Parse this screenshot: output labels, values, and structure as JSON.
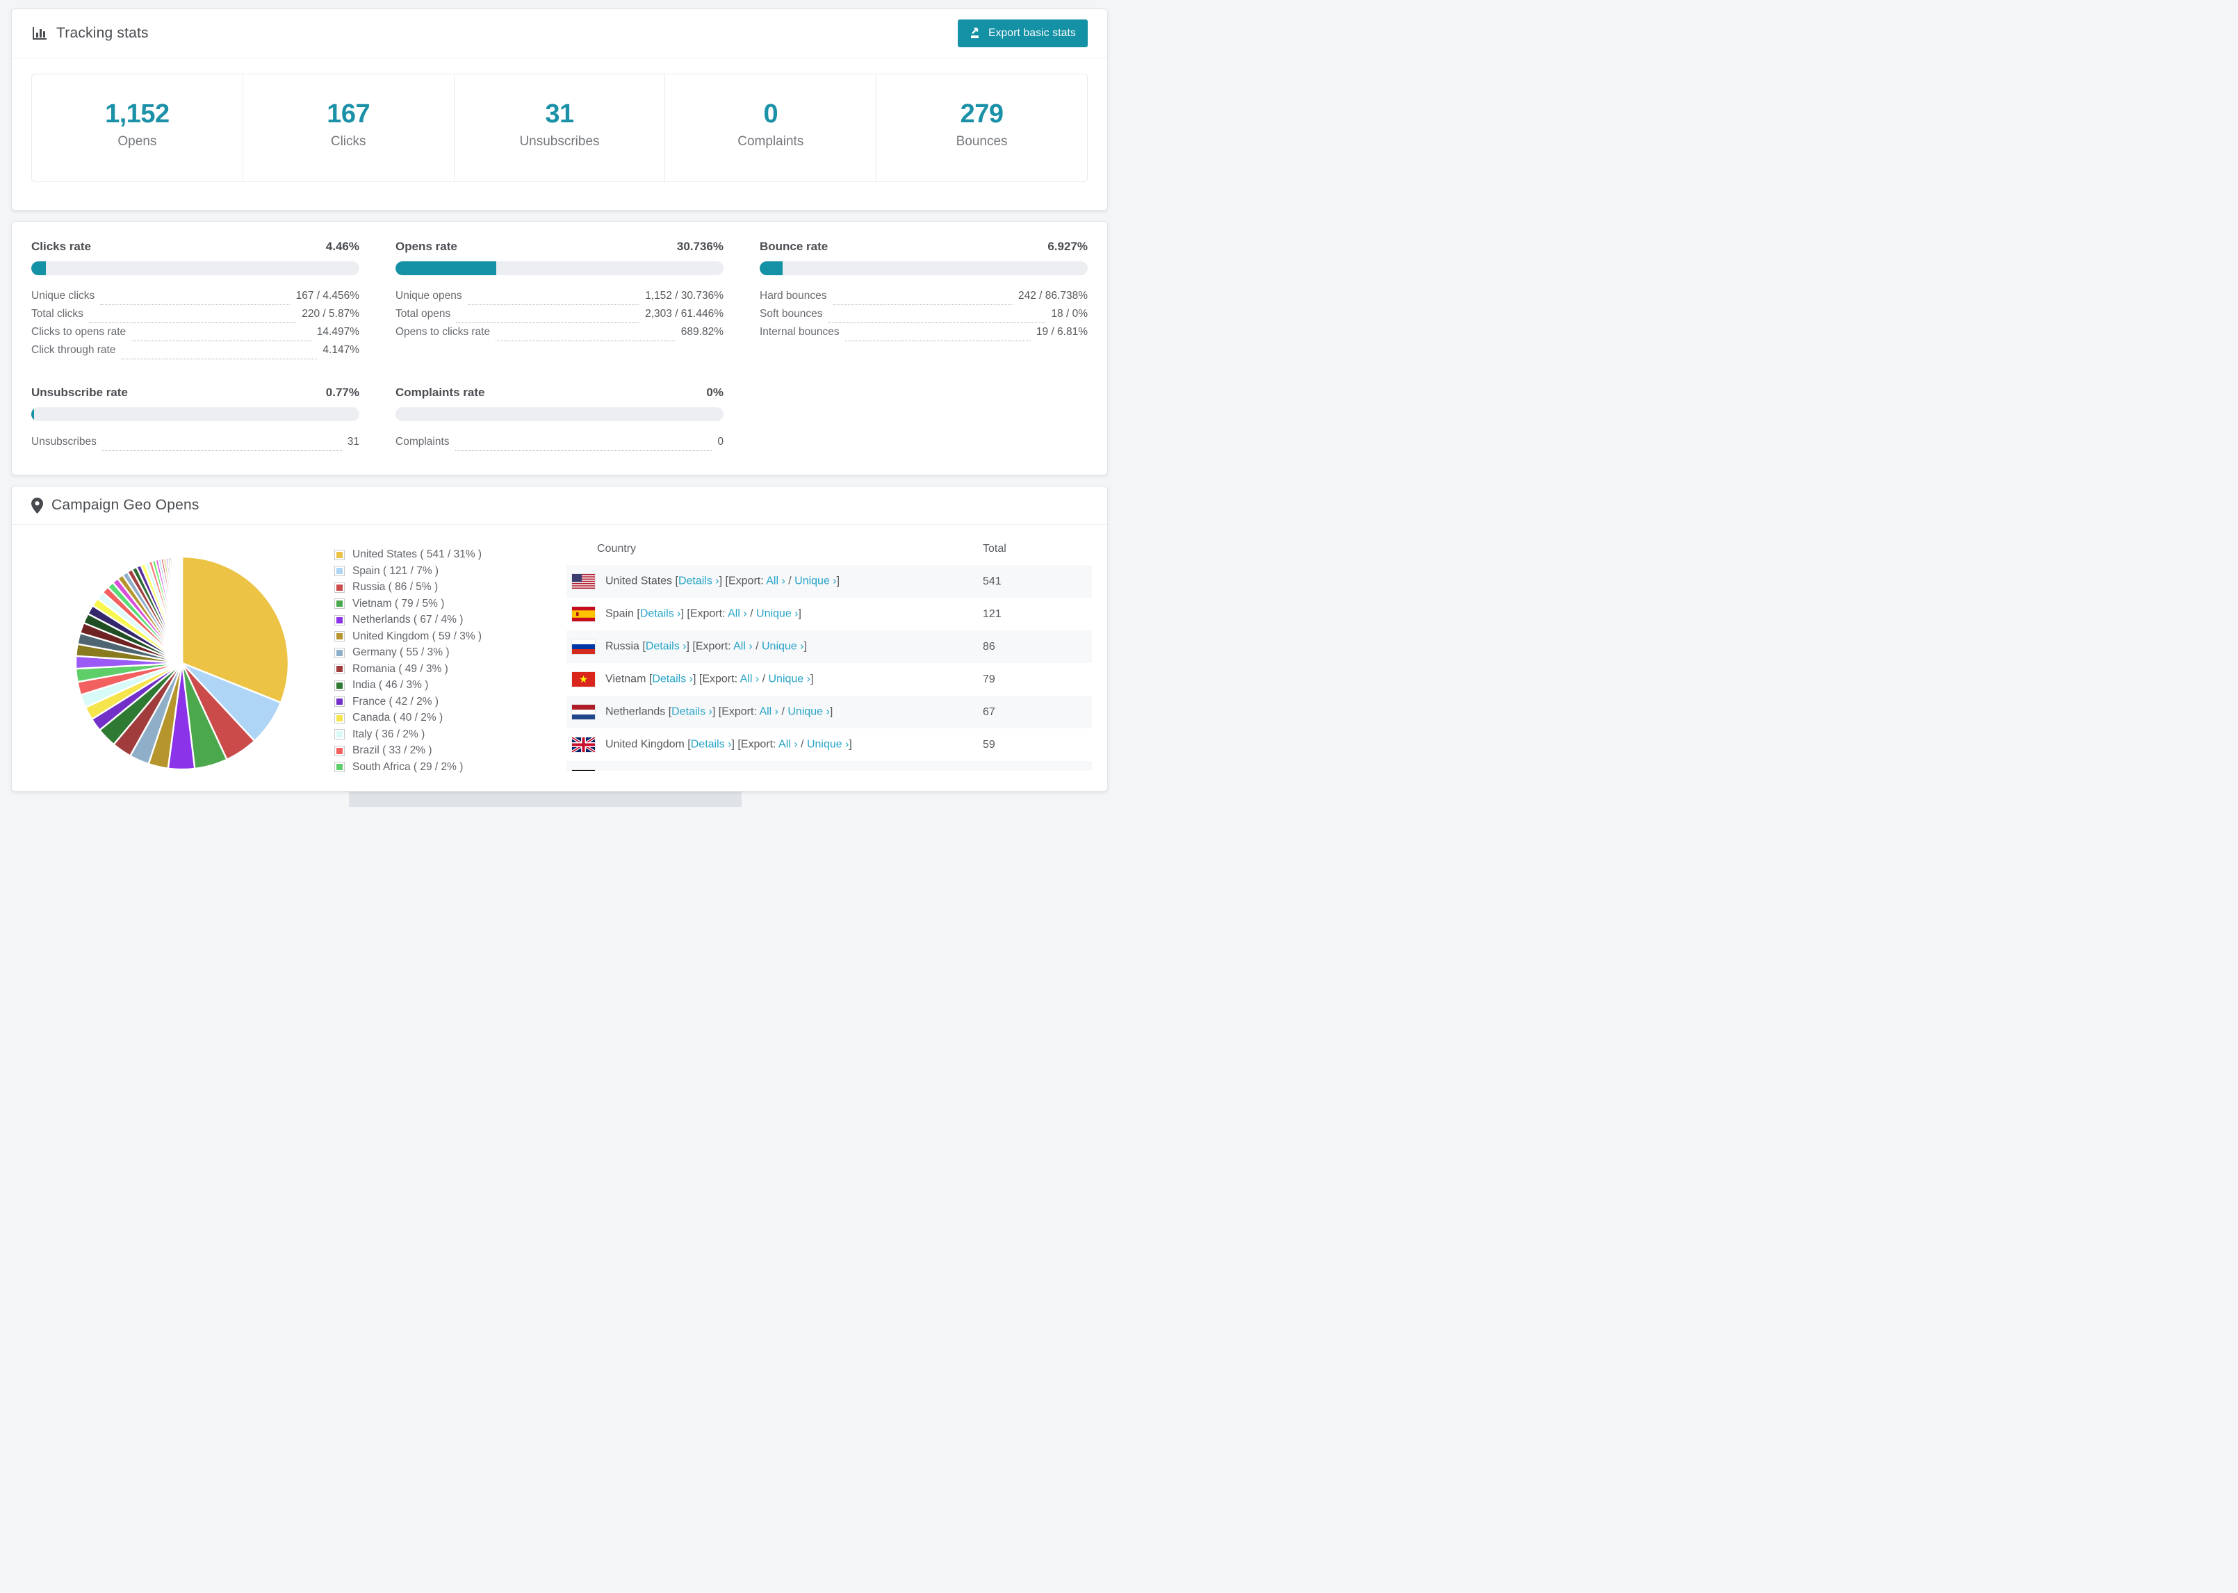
{
  "colors": {
    "accent": "#1b91a8",
    "accent_button": "#1591a5",
    "link": "#27a4c8",
    "bar_track": "#eceef1",
    "page_bg": "#f4f5f7",
    "row_stripe": "#f7f8f9"
  },
  "header": {
    "title": "Tracking stats",
    "export_label": "Export basic stats"
  },
  "summary": [
    {
      "value": "1,152",
      "label": "Opens"
    },
    {
      "value": "167",
      "label": "Clicks"
    },
    {
      "value": "31",
      "label": "Unsubscribes"
    },
    {
      "value": "0",
      "label": "Complaints"
    },
    {
      "value": "279",
      "label": "Bounces"
    }
  ],
  "rates": [
    {
      "title": "Clicks rate",
      "percent": "4.46%",
      "bar_fraction": 0.0446,
      "rows": [
        [
          "Unique clicks",
          "167 / 4.456%"
        ],
        [
          "Total clicks",
          "220 / 5.87%"
        ],
        [
          "Clicks to opens rate",
          "14.497%"
        ],
        [
          "Click through rate",
          "4.147%"
        ]
      ]
    },
    {
      "title": "Opens rate",
      "percent": "30.736%",
      "bar_fraction": 0.30736,
      "rows": [
        [
          "Unique opens",
          "1,152 / 30.736%"
        ],
        [
          "Total opens",
          "2,303 / 61.446%"
        ],
        [
          "Opens to clicks rate",
          "689.82%"
        ]
      ]
    },
    {
      "title": "Bounce rate",
      "percent": "6.927%",
      "bar_fraction": 0.06927,
      "rows": [
        [
          "Hard bounces",
          "242 / 86.738%"
        ],
        [
          "Soft bounces",
          "18 / 0%"
        ],
        [
          "Internal bounces",
          "19 / 6.81%"
        ]
      ]
    },
    {
      "title": "Unsubscribe rate",
      "percent": "0.77%",
      "bar_fraction": 0.0077,
      "rows": [
        [
          "Unsubscribes",
          "31"
        ]
      ]
    },
    {
      "title": "Complaints rate",
      "percent": "0%",
      "bar_fraction": 0,
      "rows": [
        [
          "Complaints",
          "0"
        ]
      ]
    }
  ],
  "geo": {
    "title": "Campaign Geo Opens",
    "table_headers": [
      "Country",
      "Total"
    ],
    "links": {
      "open": "[",
      "close": "]",
      "details": "Details ›",
      "export": "[Export:",
      "all": "All ›",
      "slash": "/",
      "unique": "Unique ›"
    },
    "rows": [
      {
        "flag": "us",
        "country": "United States",
        "total": "541"
      },
      {
        "flag": "es",
        "country": "Spain",
        "total": "121"
      },
      {
        "flag": "ru",
        "country": "Russia",
        "total": "86"
      },
      {
        "flag": "vn",
        "country": "Vietnam",
        "total": "79"
      },
      {
        "flag": "nl",
        "country": "Netherlands",
        "total": "67"
      },
      {
        "flag": "gb",
        "country": "United Kingdom",
        "total": "59"
      }
    ],
    "partial_next_row": {
      "flag": "de"
    }
  },
  "chart_data": {
    "type": "pie",
    "title": "Campaign Geo Opens",
    "legend_position": "right",
    "series": [
      {
        "name": "United States",
        "value": 541,
        "percent": 31,
        "color": "#ecc344"
      },
      {
        "name": "Spain",
        "value": 121,
        "percent": 7,
        "color": "#aed5f5"
      },
      {
        "name": "Russia",
        "value": 86,
        "percent": 5,
        "color": "#cb4a4a"
      },
      {
        "name": "Vietnam",
        "value": 79,
        "percent": 5,
        "color": "#4ca84d"
      },
      {
        "name": "Netherlands",
        "value": 67,
        "percent": 4,
        "color": "#8b33e8"
      },
      {
        "name": "United Kingdom",
        "value": 59,
        "percent": 3,
        "color": "#b5952c"
      },
      {
        "name": "Germany",
        "value": 55,
        "percent": 3,
        "color": "#8fafc8"
      },
      {
        "name": "Romania",
        "value": 49,
        "percent": 3,
        "color": "#a03c3c"
      },
      {
        "name": "India",
        "value": 46,
        "percent": 3,
        "color": "#2f7a33"
      },
      {
        "name": "France",
        "value": 42,
        "percent": 2,
        "color": "#7330c8"
      },
      {
        "name": "Canada",
        "value": 40,
        "percent": 2,
        "color": "#f6e44d"
      },
      {
        "name": "Italy",
        "value": 36,
        "percent": 2,
        "color": "#d9fbf8"
      },
      {
        "name": "Brazil",
        "value": 33,
        "percent": 2,
        "color": "#f2615f"
      },
      {
        "name": "South Africa",
        "value": 29,
        "percent": 2,
        "color": "#5ecf68"
      }
    ],
    "others_note": "remaining ~26% is split across many small unlabeled country slices",
    "others": [
      [
        1.9,
        "#9b59f5"
      ],
      [
        1.8,
        "#8a7a1e"
      ],
      [
        1.7,
        "#4f6672"
      ],
      [
        1.6,
        "#6e2222"
      ],
      [
        1.5,
        "#1e4e22"
      ],
      [
        1.4,
        "#35276b"
      ],
      [
        1.3,
        "#f7f74f"
      ],
      [
        1.2,
        "#e0fbf9"
      ],
      [
        1.1,
        "#f2615f"
      ],
      [
        1.0,
        "#58dd74"
      ],
      [
        0.95,
        "#d94fd9"
      ],
      [
        0.9,
        "#b5952c"
      ],
      [
        0.85,
        "#8fafc8"
      ],
      [
        0.8,
        "#a33f3f"
      ],
      [
        0.75,
        "#2d6b30"
      ],
      [
        0.7,
        "#5b2fa0"
      ],
      [
        0.65,
        "#ffff66"
      ],
      [
        0.6,
        "#d6fbf9"
      ],
      [
        0.55,
        "#ff7b7b"
      ],
      [
        0.5,
        "#66e866"
      ],
      [
        0.45,
        "#e156e1"
      ],
      [
        0.4,
        "#aed5f5"
      ],
      [
        0.38,
        "#d94343"
      ],
      [
        0.35,
        "#c9a227"
      ],
      [
        0.32,
        "#9b59f5"
      ],
      [
        0.3,
        "#8a7a1e"
      ],
      [
        0.28,
        "#4f6672"
      ],
      [
        0.25,
        "#6e2222"
      ],
      [
        0.22,
        "#1e4e22"
      ],
      [
        0.2,
        "#35276b"
      ],
      [
        0.18,
        "#f7f74f"
      ],
      [
        0.15,
        "#f2615f"
      ],
      [
        0.13,
        "#58dd74"
      ],
      [
        0.12,
        "#d94fd9"
      ],
      [
        0.1,
        "#b5952c"
      ],
      [
        0.08,
        "#8fafc8"
      ],
      [
        0.07,
        "#a33f3f"
      ],
      [
        0.06,
        "#5b2fa0"
      ]
    ]
  }
}
